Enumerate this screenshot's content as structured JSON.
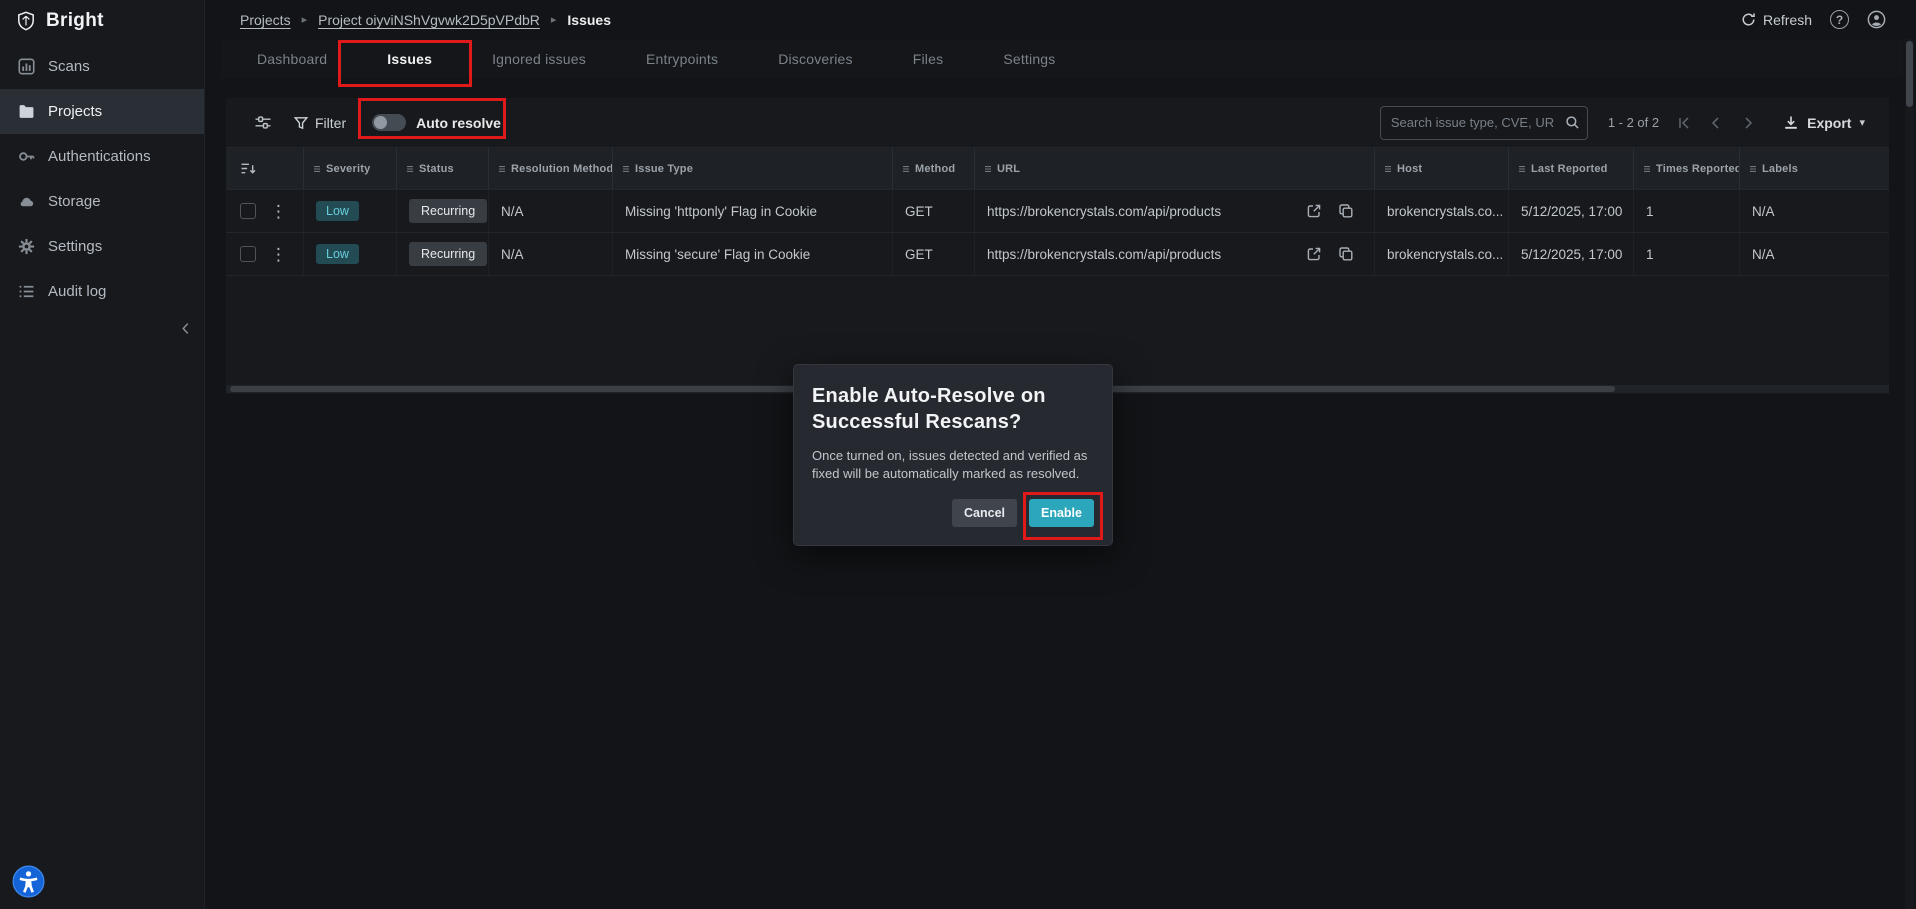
{
  "brand": {
    "name": "Bright"
  },
  "sidebar": {
    "items": [
      {
        "label": "Scans"
      },
      {
        "label": "Projects"
      },
      {
        "label": "Authentications"
      },
      {
        "label": "Storage"
      },
      {
        "label": "Settings"
      },
      {
        "label": "Audit log"
      }
    ],
    "active": "Projects"
  },
  "topbar": {
    "breadcrumb": {
      "root": "Projects",
      "project": "Project oiyviNShVgvwk2D5pVPdbR",
      "current": "Issues"
    },
    "refresh_label": "Refresh"
  },
  "tabs": {
    "items": [
      "Dashboard",
      "Issues",
      "Ignored issues",
      "Entrypoints",
      "Discoveries",
      "Files",
      "Settings"
    ],
    "active": "Issues"
  },
  "toolbar": {
    "filter_label": "Filter",
    "auto_resolve_label": "Auto resolve",
    "auto_resolve_state": "off",
    "search_placeholder": "Search issue type, CVE, URL, IDs",
    "pagination": "1 - 2 of 2",
    "export_label": "Export"
  },
  "table": {
    "headers": [
      "Severity",
      "Status",
      "Resolution Method",
      "Issue Type",
      "Method",
      "URL",
      "Host",
      "Last Reported",
      "Times Reported",
      "Labels"
    ],
    "rows": [
      {
        "severity": "Low",
        "status": "Recurring",
        "resolution_method": "N/A",
        "issue_type": "Missing 'httponly' Flag in Cookie",
        "method": "GET",
        "url": "https://brokencrystals.com/api/products",
        "host": "brokencrystals.co...",
        "last_reported": "5/12/2025, 17:00",
        "times_reported": "1",
        "labels": "N/A"
      },
      {
        "severity": "Low",
        "status": "Recurring",
        "resolution_method": "N/A",
        "issue_type": "Missing 'secure' Flag in Cookie",
        "method": "GET",
        "url": "https://brokencrystals.com/api/products",
        "host": "brokencrystals.co...",
        "last_reported": "5/12/2025, 17:00",
        "times_reported": "1",
        "labels": "N/A"
      }
    ]
  },
  "dialog": {
    "title": "Enable Auto-Resolve on Successful Rescans?",
    "body": "Once turned on, issues detected and verified as fixed will be automatically marked as resolved.",
    "cancel_label": "Cancel",
    "confirm_label": "Enable"
  },
  "icons": {
    "breadcrumb_sep": "▸",
    "kebab": "⋮",
    "caret": "▾",
    "help": "?"
  },
  "colors": {
    "accent": "#35b1c6",
    "annotation_red": "#e01a1a",
    "severity_low_bg": "#224b54",
    "severity_low_text": "#69cdda",
    "status_chip_bg": "#383d44",
    "enable_button_bg": "#2ba6bb"
  }
}
